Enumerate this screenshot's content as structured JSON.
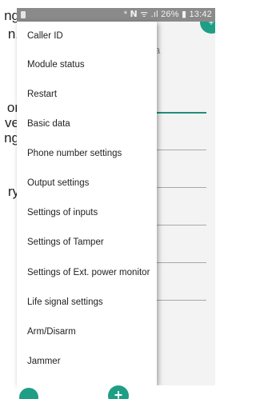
{
  "background_text": {
    "fragments": [
      "ng",
      "n.",
      "or",
      "ve",
      "ng",
      "ry"
    ]
  },
  "status_bar": {
    "text": "* 𝗡 ᯤ .ıl 26% ▮ 13:42"
  },
  "background_app": {
    "letter": "a",
    "fab_top_symbol": "+",
    "fab_bottom_symbol": "+"
  },
  "menu": {
    "items": [
      "Caller ID",
      "Module status",
      "Restart",
      "Basic data",
      "Phone number settings",
      "Output settings",
      "Settings of inputs",
      "Settings of Tamper",
      "Settings of Ext. power monitor",
      "Life signal settings",
      "Arm/Disarm",
      "Jammer"
    ]
  },
  "colors": {
    "accent": "#1f9e86",
    "status_bar": "#8a8a8a"
  }
}
